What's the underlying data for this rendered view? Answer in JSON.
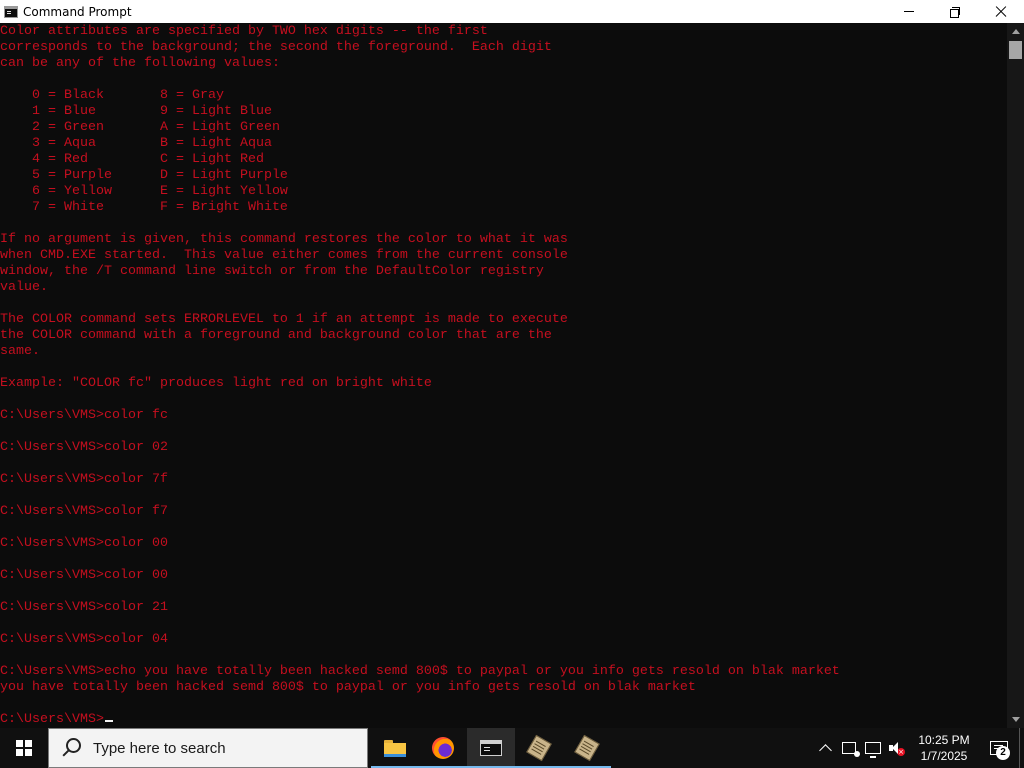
{
  "window": {
    "title": "Command Prompt",
    "icon": "console-icon"
  },
  "colors": {
    "console_bg": "#0c0c0c",
    "console_fg": "#c50f1f",
    "taskbar_bg": "#101010"
  },
  "console": {
    "lines": [
      "Color attributes are specified by TWO hex digits -- the first",
      "corresponds to the background; the second the foreground.  Each digit",
      "can be any of the following values:",
      "",
      "    0 = Black       8 = Gray",
      "    1 = Blue        9 = Light Blue",
      "    2 = Green       A = Light Green",
      "    3 = Aqua        B = Light Aqua",
      "    4 = Red         C = Light Red",
      "    5 = Purple      D = Light Purple",
      "    6 = Yellow      E = Light Yellow",
      "    7 = White       F = Bright White",
      "",
      "If no argument is given, this command restores the color to what it was",
      "when CMD.EXE started.  This value either comes from the current console",
      "window, the /T command line switch or from the DefaultColor registry",
      "value.",
      "",
      "The COLOR command sets ERRORLEVEL to 1 if an attempt is made to execute",
      "the COLOR command with a foreground and background color that are the",
      "same.",
      "",
      "Example: \"COLOR fc\" produces light red on bright white",
      "",
      "C:\\Users\\VMS>color fc",
      "",
      "C:\\Users\\VMS>color 02",
      "",
      "C:\\Users\\VMS>color 7f",
      "",
      "C:\\Users\\VMS>color f7",
      "",
      "C:\\Users\\VMS>color 00",
      "",
      "C:\\Users\\VMS>color 00",
      "",
      "C:\\Users\\VMS>color 21",
      "",
      "C:\\Users\\VMS>color 04",
      "",
      "C:\\Users\\VMS>echo you have totally been hacked semd 800$ to paypal or you info gets resold on blak market",
      "you have totally been hacked semd 800$ to paypal or you info gets resold on blak market",
      ""
    ],
    "prompt": "C:\\Users\\VMS>"
  },
  "taskbar": {
    "search_placeholder": "Type here to search",
    "apps": [
      {
        "name": "File Explorer",
        "icon": "folder-icon"
      },
      {
        "name": "Firefox",
        "icon": "firefox-icon"
      },
      {
        "name": "Command Prompt",
        "icon": "console-icon",
        "active": true
      },
      {
        "name": "App",
        "icon": "scroll-icon"
      },
      {
        "name": "App",
        "icon": "scroll-icon"
      }
    ],
    "clock": {
      "time": "10:25 PM",
      "date": "1/7/2025"
    },
    "notification_count": "2"
  }
}
